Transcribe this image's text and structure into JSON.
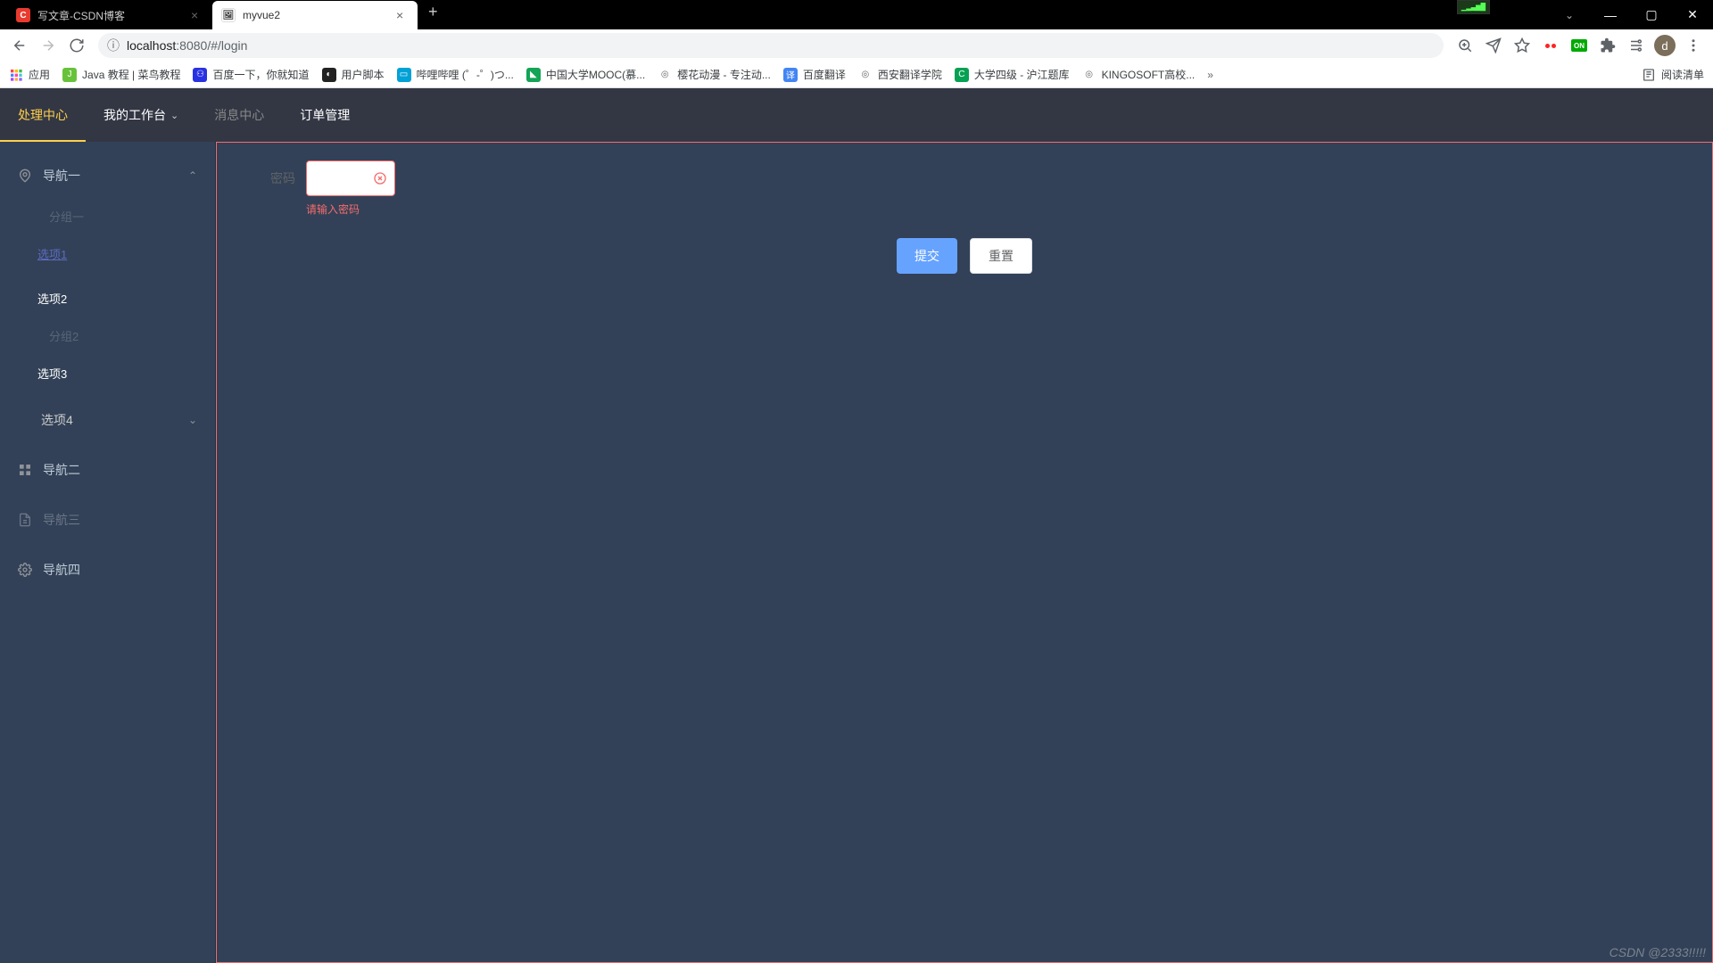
{
  "browser": {
    "tabs": [
      {
        "title": "写文章-CSDN博客",
        "active": false,
        "icon_bg": "#e83a2e",
        "icon_text": "C",
        "icon_color": "#fff"
      },
      {
        "title": "myvue2",
        "active": true,
        "icon_bg": "#fff",
        "icon_text": "🖼",
        "icon_color": "#333"
      }
    ],
    "url_prefix": "ⓘ",
    "url_host": "localhost",
    "url_port": ":8080",
    "url_path": "/#/login",
    "avatar_letter": "d",
    "gpu_hint": "▁▂▃▅▇"
  },
  "bookmarks": {
    "apps": "应用",
    "items": [
      {
        "label": "Java 教程 | 菜鸟教程",
        "icon_bg": "#67c23a",
        "icon_text": "J"
      },
      {
        "label": "百度一下，你就知道",
        "icon_bg": "#2932e1",
        "icon_text": "⚇"
      },
      {
        "label": "用户脚本",
        "icon_bg": "#222",
        "icon_text": "◐"
      },
      {
        "label": "哔哩哔哩 (゜-゜)つ...",
        "icon_bg": "#00a1d6",
        "icon_text": "▭"
      },
      {
        "label": "中国大学MOOC(慕...",
        "icon_bg": "#13a456",
        "icon_text": "◣"
      },
      {
        "label": "樱花动漫 - 专注动...",
        "icon_bg": "#fff",
        "icon_text": "◎"
      },
      {
        "label": "百度翻译",
        "icon_bg": "#4285f4",
        "icon_text": "译"
      },
      {
        "label": "西安翻译学院",
        "icon_bg": "#fff",
        "icon_text": "◎"
      },
      {
        "label": "大学四级 - 沪江题库",
        "icon_bg": "#06a152",
        "icon_text": "C"
      },
      {
        "label": "KINGOSOFT高校...",
        "icon_bg": "#fff",
        "icon_text": "◎"
      }
    ],
    "reading_list": "阅读清单"
  },
  "topnav": {
    "items": [
      {
        "label": "处理中心",
        "active": true
      },
      {
        "label": "我的工作台",
        "dropdown": true
      },
      {
        "label": "消息中心",
        "disabled": true
      },
      {
        "label": "订单管理"
      }
    ]
  },
  "sidebar": {
    "nav1": {
      "label": "导航一"
    },
    "group1": "分组一",
    "opt1": "选项1",
    "opt2": "选项2",
    "group2": "分组2",
    "opt3": "选项3",
    "opt4": "选项4",
    "nav2": {
      "label": "导航二"
    },
    "nav3": {
      "label": "导航三"
    },
    "nav4": {
      "label": "导航四"
    }
  },
  "form": {
    "password_label": "密码",
    "password_error": "请输入密码",
    "submit": "提交",
    "reset": "重置"
  },
  "watermark": "CSDN @2333!!!!!"
}
